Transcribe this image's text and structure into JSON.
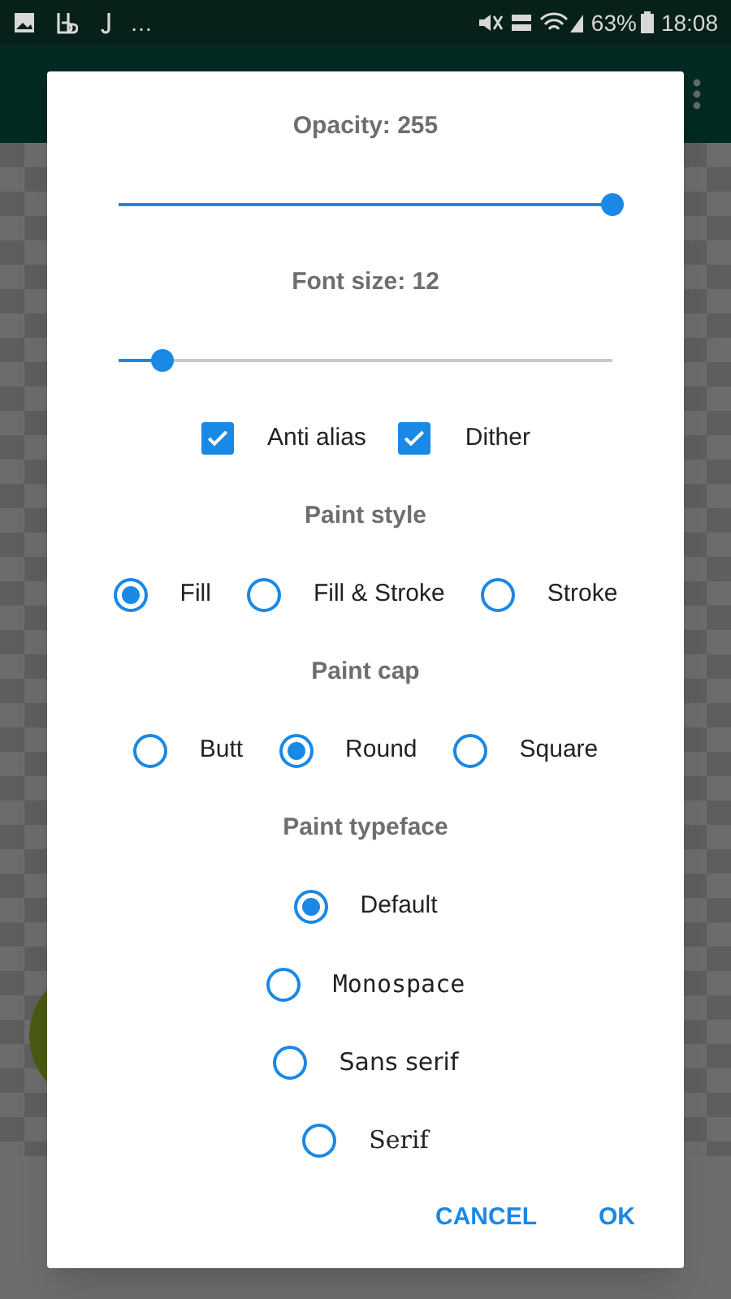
{
  "status_bar": {
    "overflow": "…",
    "battery": "63%",
    "time": "18:08"
  },
  "dialog": {
    "opacity": {
      "label": "Opacity: 255",
      "level": 1
    },
    "font_size": {
      "label": "Font size: 12",
      "level": 0.09
    },
    "checkboxes": [
      {
        "label": "Anti alias",
        "checked": true
      },
      {
        "label": "Dither",
        "checked": true
      }
    ],
    "paint_style": {
      "title": "Paint style",
      "options": [
        {
          "label": "Fill",
          "selected": true
        },
        {
          "label": "Fill & Stroke",
          "selected": false
        },
        {
          "label": "Stroke",
          "selected": false
        }
      ]
    },
    "paint_cap": {
      "title": "Paint cap",
      "options": [
        {
          "label": "Butt",
          "selected": false
        },
        {
          "label": "Round",
          "selected": true
        },
        {
          "label": "Square",
          "selected": false
        }
      ]
    },
    "paint_typeface": {
      "title": "Paint typeface",
      "options": [
        {
          "label": "Default",
          "kind": "default",
          "selected": true
        },
        {
          "label": "Monospace",
          "kind": "monospace",
          "selected": false
        },
        {
          "label": "Sans serif",
          "kind": "sans",
          "selected": false
        },
        {
          "label": "Serif",
          "kind": "serif",
          "selected": false
        }
      ]
    },
    "buttons": [
      "CANCEL",
      "OK"
    ]
  }
}
